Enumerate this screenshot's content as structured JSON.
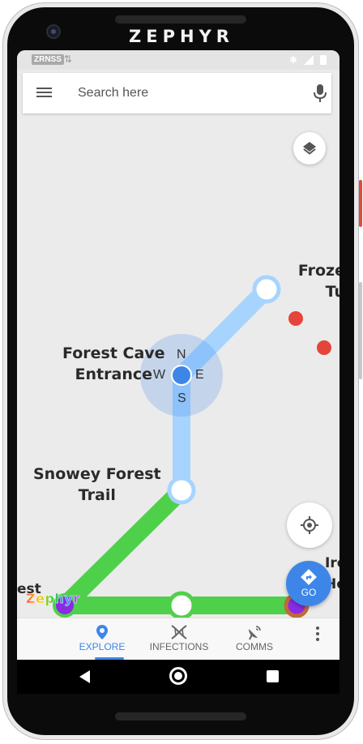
{
  "device": {
    "brand": "ZEPHYR"
  },
  "status_bar": {
    "carrier": "ZRNSS",
    "data_arrows": "⇅"
  },
  "search": {
    "placeholder": "Search here"
  },
  "map": {
    "labels": {
      "forest_cave": "Forest Cave\nEntrance",
      "snowey_forest": "Snowey Forest\nTrail",
      "frozen_partial": "Froze\nTu",
      "iro_partial": "Iro\nHo",
      "est_partial": "est"
    },
    "compass": {
      "n": "N",
      "s": "S",
      "e": "E",
      "w": "W"
    },
    "colors": {
      "route_active": "#4fd04a",
      "route_planned": "#a6d4ff",
      "hazard": "#e5443a",
      "player": "#3d86e8",
      "waypoint_purple": "#8a2be2"
    }
  },
  "go_button": {
    "label": "GO"
  },
  "logo": {
    "text": "Zephyr"
  },
  "bottom_nav": {
    "items": [
      {
        "label": "EXPLORE",
        "icon": "map-pin-icon",
        "active": true
      },
      {
        "label": "INFECTIONS",
        "icon": "dna-icon",
        "active": false
      },
      {
        "label": "COMMS",
        "icon": "satellite-dish-icon",
        "active": false
      }
    ]
  }
}
